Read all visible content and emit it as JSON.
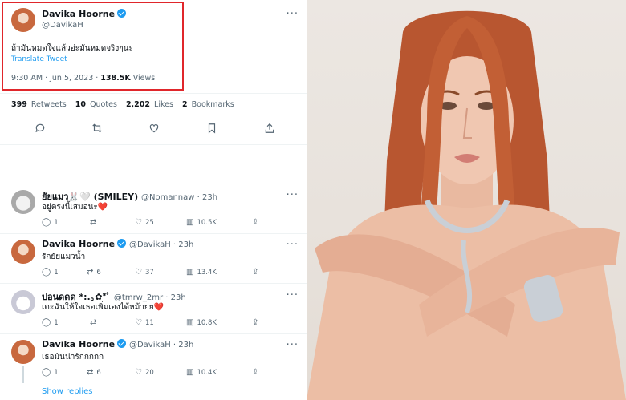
{
  "main_tweet": {
    "name": "Davika Hoorne",
    "handle": "@DavikaH",
    "text": "ถ้ามันหมดใจแล้วอ่ะมันหมดจริงๆนะ",
    "translate": "Translate Tweet",
    "time": "9:30 AM · Jun 5, 2023 · ",
    "views": "138.5K",
    "views_label": " Views",
    "more": "···"
  },
  "stats": {
    "retweets": "399",
    "retweets_label": "Retweets",
    "quotes": "10",
    "quotes_label": "Quotes",
    "likes": "2,202",
    "likes_label": "Likes",
    "bookmarks": "2",
    "bookmarks_label": "Bookmarks"
  },
  "replies": [
    {
      "name": "ยัยแมว🐰🤍 (SMILEY)",
      "handle": "@Nomannaw · 23h",
      "text": "อยู่ตรงนี้เสมอนะ❤️",
      "reply": "1",
      "retweet": "",
      "like": "25",
      "views": "10.5K"
    },
    {
      "name": "Davika Hoorne",
      "handle": "@DavikaH · 23h",
      "text": "รักยัยแมวน้ำ",
      "reply": "1",
      "retweet": "6",
      "like": "37",
      "views": "13.4K"
    },
    {
      "name": "ปอนดดด *:.｡✿*ﾟ",
      "handle": "@tmrw_2mr · 23h",
      "text": "เดะฉันให้ใจเธอเพิ่มเองได้หม้ายย❤️",
      "reply": "1",
      "retweet": "",
      "like": "11",
      "views": "10.8K"
    },
    {
      "name": "Davika Hoorne",
      "handle": "@DavikaH · 23h",
      "text": "เธอมันน่ารักกกกก",
      "reply": "1",
      "retweet": "6",
      "like": "20",
      "views": "10.4K"
    }
  ],
  "show_replies": "Show replies",
  "icons": [
    "reply-icon",
    "retweet-icon",
    "like-icon",
    "bookmark-icon",
    "share-icon",
    "views-icon",
    "verified-icon",
    "more-icon"
  ],
  "colors": {
    "accent": "#1d9bf0",
    "highlight": "#e0262b",
    "text": "#0f1419",
    "muted": "#536471"
  }
}
